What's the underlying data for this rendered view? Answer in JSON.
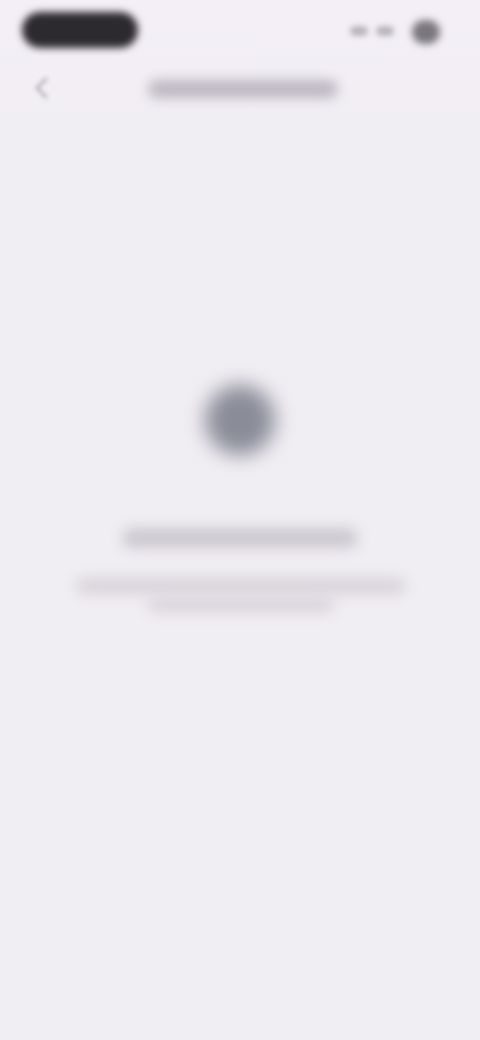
{
  "status_bar": {
    "icons": [
      "time-pill",
      "signal-icon",
      "wifi-icon",
      "battery-icon"
    ]
  },
  "nav_bar": {
    "back_icon": "chevron-left-icon",
    "title": ""
  },
  "empty_state": {
    "icon": "info-icon",
    "headline": "",
    "message": ""
  },
  "colors": {
    "background": "#f1eef3",
    "status_pill": "#2d2a2f",
    "icon_fill": "#8a8c98",
    "text_placeholder": "#cbc7cf"
  }
}
